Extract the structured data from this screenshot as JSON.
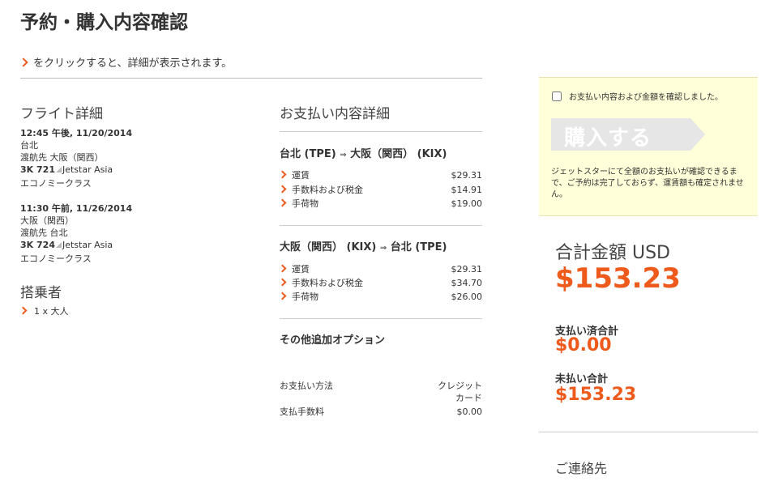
{
  "page_title": "予約・購入内容確認",
  "hint": "をクリックすると、詳細が表示されます。",
  "flight_details": {
    "heading": "フライト詳細",
    "flights": [
      {
        "datetime": "12:45 午後, 11/20/2014",
        "origin": "台北",
        "destination": "渡航先 大阪（関西）",
        "flight_no": "3K 721",
        "airline": "Jetstar Asia",
        "class": "エコノミークラス"
      },
      {
        "datetime": "11:30 午前, 11/26/2014",
        "origin": "大阪（関西）",
        "destination": "渡航先 台北",
        "flight_no": "3K 724",
        "airline": "Jetstar Asia",
        "class": "エコノミークラス"
      }
    ]
  },
  "passengers": {
    "heading": "搭乗者",
    "item": "1 x 大人"
  },
  "payment_details": {
    "heading": "お支払い内容詳細",
    "legs": [
      {
        "from": "台北 (TPE)",
        "to": "大阪（関西） (KIX)",
        "fees": [
          {
            "label": "運賃",
            "amount": "$29.31"
          },
          {
            "label": "手数料および税金",
            "amount": "$14.91"
          },
          {
            "label": "手荷物",
            "amount": "$19.00"
          }
        ]
      },
      {
        "from": "大阪（関西） (KIX)",
        "to": "台北 (TPE)",
        "fees": [
          {
            "label": "運賃",
            "amount": "$29.31"
          },
          {
            "label": "手数料および税金",
            "amount": "$34.70"
          },
          {
            "label": "手荷物",
            "amount": "$26.00"
          }
        ]
      }
    ],
    "extras_heading": "その他追加オプション",
    "method_label": "お支払い方法",
    "method_value_1": "クレジット",
    "method_value_2": "カード",
    "fee_label": "支払手数料",
    "fee_value": "$0.00",
    "arrow": "⇒"
  },
  "confirm": {
    "checkbox_label": "お支払い内容および金額を確認しました。",
    "buy_button": "購入する",
    "note": "ジェットスターにて全額のお支払いが確認できるまで、ご予約は完了しておらず、運賃額も確定されません。"
  },
  "totals": {
    "total_label": "合計金額 USD",
    "total_value": "$153.23",
    "paid_label": "支払い済合計",
    "paid_value": "$0.00",
    "unpaid_label": "未払い合計",
    "unpaid_value": "$153.23"
  },
  "contact_heading": "ご連絡先",
  "colors": {
    "accent": "#ee5a1c",
    "confirm_bg": "#ffffd9",
    "button_disabled": "#e6e6e6"
  }
}
